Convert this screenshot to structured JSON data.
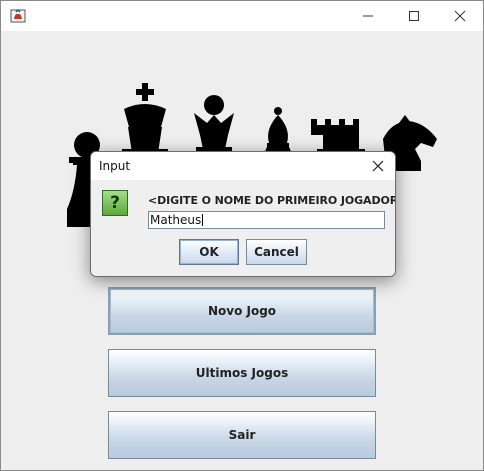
{
  "window": {
    "minimize_icon": "minimize-icon",
    "maximize_icon": "maximize-icon",
    "close_icon": "close-icon"
  },
  "menu": {
    "new_game": "Novo Jogo",
    "last_games": "Ultimos Jogos",
    "exit": "Sair"
  },
  "dialog": {
    "title": "Input",
    "message": "<DIGITE O NOME DO PRIMEIRO JOGADOR>",
    "input_value": "Matheus",
    "ok_label": "OK",
    "cancel_label": "Cancel",
    "icon": "question-icon"
  },
  "colors": {
    "piece": "#000000",
    "question_icon": "#6cbf4a",
    "button_gradient_bottom": "#b8cadd"
  }
}
